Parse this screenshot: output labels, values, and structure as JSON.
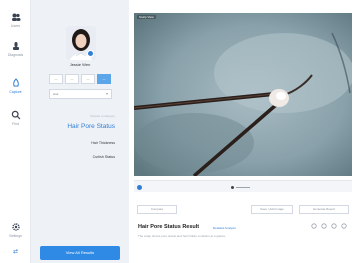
{
  "app": {
    "rail_items": [
      {
        "name": "rail-item-users",
        "icon": "users-icon",
        "label": "Users"
      },
      {
        "name": "rail-item-stethoscope",
        "icon": "stethoscope-icon",
        "label": "Diagnosis"
      },
      {
        "name": "rail-item-capture",
        "icon": "camera-icon",
        "label": "Capture"
      },
      {
        "name": "rail-item-search",
        "icon": "search-icon",
        "label": "Find"
      },
      {
        "name": "rail-item-settings",
        "icon": "gear-icon",
        "label": "Settings"
      }
    ],
    "bottom_label": "⇄"
  },
  "panel": {
    "user_name": "Jessie Wen",
    "segments": [
      "—",
      "—",
      "—",
      "—"
    ],
    "dropdown_value": "Hair",
    "hint": "Choose a category",
    "menu_selected": "Hair Pore Status",
    "menu_items": [
      "Hair Thickness",
      "Curlish Status"
    ],
    "view_button": "View All Results"
  },
  "viewer": {
    "tag": "Scalp View"
  },
  "controls": {
    "btn_left": "Compare",
    "btn_right_1": "Save / Add Image",
    "btn_right_2": "Generate Report"
  },
  "result": {
    "title": "Hair Pore Status Result",
    "tag": "Detailed Analysis",
    "sub": "The scalp shows pore status and hair follicle condition at a glance."
  },
  "colors": {
    "accent": "#2f7fd6",
    "panel_bg": "#eef1f6",
    "button_bg": "#2f8ae6"
  }
}
